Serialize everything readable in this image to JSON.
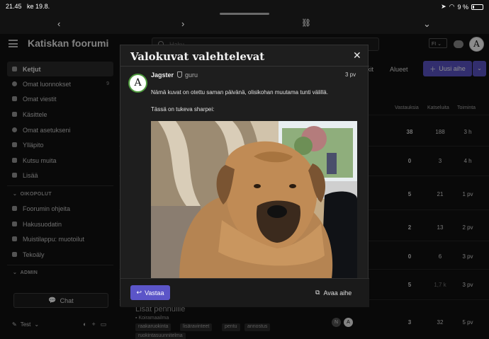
{
  "status_bar": {
    "time": "21.45",
    "date": "ke 19.8.",
    "battery": "9 %"
  },
  "browser_bar": {
    "back_glyph": "‹",
    "forward_glyph": "›",
    "link_glyph": "⛓",
    "menu_glyph": "⌄"
  },
  "header": {
    "site_title": "Katiskan foorumi",
    "search_placeholder": "Haku",
    "language": "FI",
    "avatar_letter": "A"
  },
  "sidebar": {
    "items": [
      {
        "label": "Ketjut",
        "icon": "layers-icon",
        "active": true
      },
      {
        "label": "Omat luonnokset",
        "icon": "user-icon",
        "count": "9"
      },
      {
        "label": "Omat viestit",
        "icon": "inbox-icon"
      },
      {
        "label": "Käsittele",
        "icon": "flag-icon"
      },
      {
        "label": "Omat asetukseni",
        "icon": "gear-icon"
      },
      {
        "label": "Ylläpito",
        "icon": "wrench-icon"
      },
      {
        "label": "Kutsu muita",
        "icon": "user-plus-icon"
      },
      {
        "label": "Lisää",
        "icon": "more-icon"
      }
    ],
    "section_links": "OIKOPOLUT",
    "links": [
      {
        "label": "Foorumin ohjeita",
        "icon": "bell-icon"
      },
      {
        "label": "Hakusuodatin",
        "icon": "filter-icon"
      },
      {
        "label": "Muistilappu: muotoilut",
        "icon": "info-icon"
      },
      {
        "label": "Tekoäly",
        "icon": "robot-icon"
      }
    ],
    "section_admin": "ADMIN",
    "chat_label": "Chat",
    "footer_label": "Test"
  },
  "topic_list": {
    "tabs": [
      "rkit",
      "Alueet"
    ],
    "new_topic_label": "Uusi aihe",
    "columns": [
      "Vastauksia",
      "Katseluita",
      "Toiminta"
    ],
    "rows": [
      {
        "replies": "38",
        "views": "188",
        "activity": "3 h"
      },
      {
        "replies": "0",
        "views": "3",
        "activity": "4 h"
      },
      {
        "replies": "5",
        "views": "21",
        "activity": "1 pv"
      },
      {
        "replies": "2",
        "views": "13",
        "activity": "2 pv"
      },
      {
        "replies": "0",
        "views": "6",
        "activity": "3 pv"
      },
      {
        "replies": "5",
        "views": "1,7 k",
        "activity": "3 pv"
      },
      {
        "replies": "3",
        "views": "32",
        "activity": "5 pv"
      }
    ],
    "last_topic_title": "Lisät pennuille",
    "last_topic_category": "Koiramaailma",
    "last_topic_tags": [
      "raakaruokinta",
      "lisäravinteet",
      "pentu",
      "annostus",
      "ruokintasuunnitelma"
    ],
    "avatars": [
      "N",
      "A"
    ]
  },
  "modal": {
    "title": "Valokuvat valehtelevat",
    "close_glyph": "✕",
    "post": {
      "username": "Jagster",
      "group": "guru",
      "date": "3 pv",
      "avatar_letter": "A",
      "paragraph_1": "Nämä kuvat on otettu saman päivänä, olisikohan muutama tunti välillä.",
      "paragraph_2": "Tässä on tukeva sharpei:"
    },
    "reply_label": "Vastaa",
    "open_topic_label": "Avaa aihe"
  }
}
